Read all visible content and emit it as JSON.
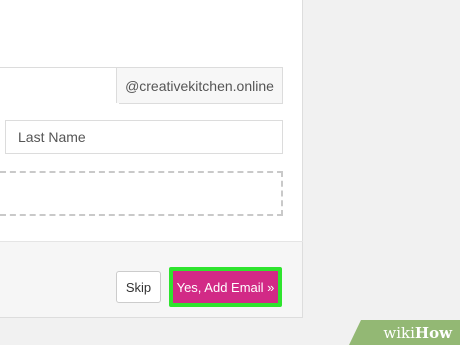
{
  "email": {
    "username_value": "",
    "domain_suffix": "@creativekitchen.online"
  },
  "name": {
    "first_name_value": "",
    "last_name_placeholder": "Last Name"
  },
  "footer": {
    "skip_label": "Skip",
    "add_email_label": "Yes, Add Email »"
  },
  "watermark": {
    "part1": "wiki",
    "part2": "How"
  },
  "colors": {
    "primary_button": "#d22a86",
    "highlight_outline": "#2ee42e",
    "watermark_bg": "#93b874"
  }
}
